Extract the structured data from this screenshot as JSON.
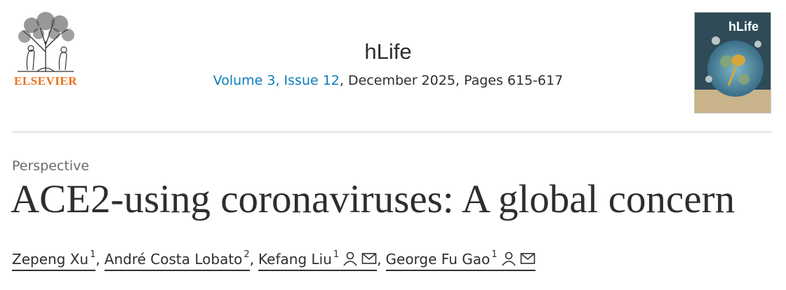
{
  "publisher": {
    "name": "ELSEVIER",
    "logo_icon": "elsevier-tree-logo"
  },
  "journal": {
    "title": "hLife",
    "volume_issue": "Volume 3, Issue 12",
    "date_pages": ", December 2025, Pages 615-617",
    "cover": {
      "title": "hLife",
      "icon": "journal-cover-image"
    }
  },
  "article": {
    "type": "Perspective",
    "title": "ACE2-using coronaviruses: A global concern"
  },
  "authors": [
    {
      "name": "Zepeng Xu",
      "sup": "1",
      "separator": ","
    },
    {
      "name": "André Costa Lobato",
      "sup": "2",
      "separator": ","
    },
    {
      "name": "Kefang Liu",
      "sup": "1",
      "separator": ",",
      "icons": [
        "person-icon",
        "mail-icon"
      ]
    },
    {
      "name": "George Fu Gao",
      "sup": "1",
      "icons": [
        "person-icon",
        "mail-icon"
      ]
    }
  ],
  "colors": {
    "link": "#0c7dbb",
    "publisher": "#e9711c",
    "text": "#2e2e2e"
  }
}
